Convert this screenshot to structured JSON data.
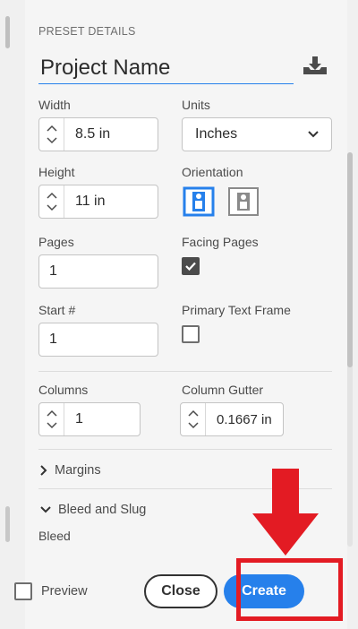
{
  "panel": {
    "section_title": "PRESET DETAILS",
    "project_name": "Project Name"
  },
  "fields": {
    "width_label": "Width",
    "width_value": "8.5 in",
    "units_label": "Units",
    "units_value": "Inches",
    "height_label": "Height",
    "height_value": "11 in",
    "orientation_label": "Orientation",
    "pages_label": "Pages",
    "pages_value": "1",
    "facing_pages_label": "Facing Pages",
    "start_label": "Start #",
    "start_value": "1",
    "primary_text_frame_label": "Primary Text Frame",
    "columns_label": "Columns",
    "columns_value": "1",
    "column_gutter_label": "Column Gutter",
    "column_gutter_value": "0.1667 in"
  },
  "sections": {
    "margins": "Margins",
    "bleed_and_slug": "Bleed and Slug",
    "bleed": "Bleed"
  },
  "footer": {
    "preview_label": "Preview",
    "close_label": "Close",
    "create_label": "Create"
  },
  "state": {
    "facing_pages_checked": true,
    "primary_text_frame_checked": false,
    "preview_checked": false,
    "orientation_selected": "portrait"
  },
  "colors": {
    "accent": "#2680eb",
    "highlight": "#e31b23",
    "panel_bg": "#f5f5f5"
  },
  "icons": {
    "save_preset": "save-preset-icon",
    "portrait": "portrait-icon",
    "landscape": "landscape-icon",
    "units_dropdown": "chevron-down-icon",
    "margins_toggle": "chevron-right-icon",
    "bleed_toggle": "chevron-down-icon"
  }
}
